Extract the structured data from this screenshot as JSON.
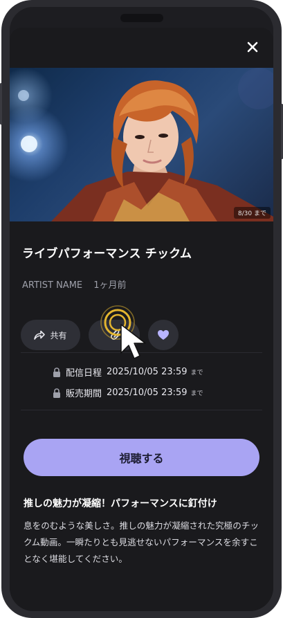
{
  "colors": {
    "accent": "#a9a4f3",
    "like": "#b8b4ff",
    "background": "#1a1a1d"
  },
  "header": {
    "close_icon": "close-icon"
  },
  "hero": {
    "badge": "8/30 まで"
  },
  "content": {
    "title": "ライブパフォーマンス チックム",
    "artist": "ARTIST NAME",
    "posted": "1ヶ月前"
  },
  "actions": {
    "share_label": "共有",
    "share_icon": "share-icon",
    "clip_icon": "clip-icon",
    "like_icon": "heart-icon"
  },
  "info": {
    "delivery_label": "配信日程",
    "delivery_value": "2025/10/05 23:59",
    "delivery_suffix": "まで",
    "sale_label": "販売期間",
    "sale_value": "2025/10/05 23:59",
    "sale_suffix": "まで"
  },
  "cta": {
    "label": "視聴する"
  },
  "description": {
    "headline": "推しの魅力が凝縮！パフォーマンスに釘付け",
    "body": "息をのむような美しさ。推しの魅力が凝縮された究極のチックム動画。一瞬たりとも見逃せないパフォーマンスを余すことなく堪能してください。"
  }
}
